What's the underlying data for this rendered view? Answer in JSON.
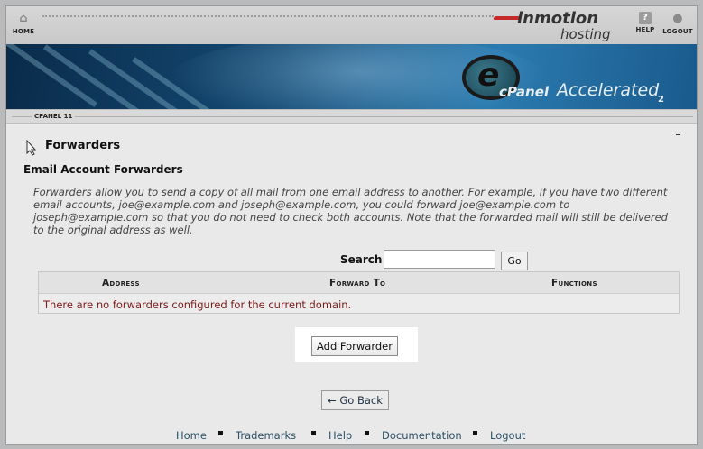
{
  "topnav": {
    "home_label": "HOME",
    "help_label": "HELP",
    "logout_label": "LOGOUT",
    "logo_primary": "inmotion",
    "logo_secondary": "hosting"
  },
  "banner": {
    "brand_cpanel": "cPanel",
    "brand_accelerated": "Accelerated",
    "brand_version_mark": "2"
  },
  "version_bar": {
    "label": "CPANEL 11"
  },
  "page": {
    "title": "Forwarders",
    "section_title": "Email Account Forwarders",
    "intro": "Forwarders allow you to send a copy of all mail from one email address to another. For example, if you have two different email accounts, joe@example.com and joseph@example.com, you could forward joe@example.com to joseph@example.com so that you do not need to check both accounts. Note that the forwarded mail will still be delivered to the original address as well."
  },
  "search": {
    "label": "Search",
    "value": "",
    "go_label": "Go"
  },
  "table": {
    "columns": [
      "Address",
      "Forward To",
      "Functions"
    ],
    "empty_message": "There are no forwarders configured for the current domain."
  },
  "actions": {
    "add_forwarder": "Add Forwarder",
    "go_back": "← Go Back"
  },
  "footer": {
    "links": [
      "Home",
      "Trademarks",
      "Help",
      "Documentation",
      "Logout"
    ]
  },
  "colors": {
    "accent_red": "#c62b2b",
    "link": "#2a4f66",
    "empty_message": "#7a1a1a"
  }
}
